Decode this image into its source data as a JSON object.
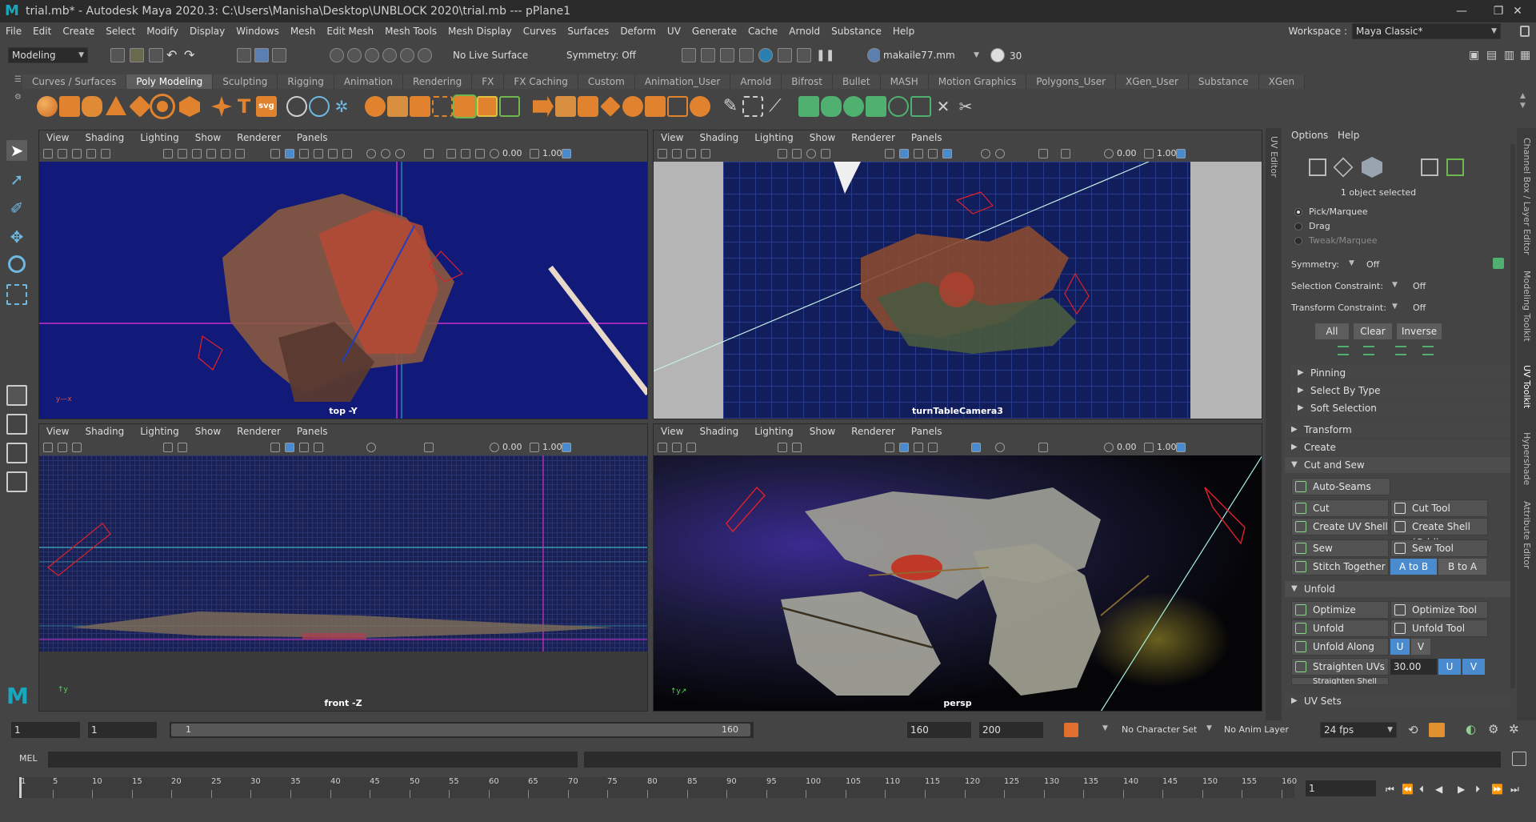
{
  "titlebar": {
    "logo": "M",
    "title": "trial.mb* - Autodesk Maya 2020.3: C:\\Users\\Manisha\\Desktop\\UNBLOCK 2020\\trial.mb  ---  pPlane1",
    "minimize": "—",
    "restore": "❐",
    "close": "✕"
  },
  "menubar": {
    "items": [
      "File",
      "Edit",
      "Create",
      "Select",
      "Modify",
      "Display",
      "Windows",
      "Mesh",
      "Edit Mesh",
      "Mesh Tools",
      "Mesh Display",
      "Curves",
      "Surfaces",
      "Deform",
      "UV",
      "Generate",
      "Cache",
      "Arnold",
      "Substance",
      "Help"
    ],
    "workspace_label": "Workspace :",
    "workspace_value": "Maya Classic*"
  },
  "statusline": {
    "menuset": "Modeling",
    "live_surface": "No Live Surface",
    "symmetry": "Symmetry: Off",
    "user": "makaile77.mm",
    "credits": "30"
  },
  "shelf": {
    "tabs": [
      "Curves / Surfaces",
      "Poly Modeling",
      "Sculpting",
      "Rigging",
      "Animation",
      "Rendering",
      "FX",
      "FX Caching",
      "Custom",
      "Animation_User",
      "Arnold",
      "Bifrost",
      "Bullet",
      "MASH",
      "Motion Graphics",
      "Polygons_User",
      "XGen_User",
      "Substance",
      "XGen"
    ],
    "active_tab": "Poly Modeling",
    "text_icons": [
      "T",
      "svg"
    ]
  },
  "viewports": {
    "menu": [
      "View",
      "Shading",
      "Lighting",
      "Show",
      "Renderer",
      "Panels"
    ],
    "value_a": "0.00",
    "value_b": "1.00",
    "top_label": "top -Y",
    "turntable_label": "turnTableCamera3",
    "front_label": "front -Z",
    "persp_label": "persp"
  },
  "uv_editor_tab": "UV Editor",
  "right_tabs": [
    "Channel Box / Layer Editor",
    "Modeling Toolkit",
    "UV Toolkit",
    "Hypershade",
    "Attribute Editor"
  ],
  "toolkit": {
    "menu": [
      "Options",
      "Help"
    ],
    "selected_info": "1 object selected",
    "modes": [
      "Pick/Marquee",
      "Drag",
      "Tweak/Marquee"
    ],
    "symmetry_label": "Symmetry:",
    "symmetry_value": "Off",
    "sel_constraint_label": "Selection Constraint:",
    "sel_constraint_value": "Off",
    "xform_constraint_label": "Transform Constraint:",
    "xform_constraint_value": "Off",
    "sel_buttons": [
      "All",
      "Clear",
      "Inverse"
    ],
    "sub_sections": [
      "Pinning",
      "Select By Type",
      "Soft Selection"
    ],
    "sections": {
      "transform": "Transform",
      "create": "Create",
      "cut_sew": "Cut and Sew",
      "unfold": "Unfold",
      "uv_sets": "UV Sets"
    },
    "cut_sew": {
      "auto_seams": "Auto-Seams",
      "cut": "Cut",
      "cut_tool": "Cut Tool",
      "create_uv_shell": "Create UV Shell",
      "create_shell_grid": "Create Shell (Grid)",
      "sew": "Sew",
      "sew_tool": "Sew Tool",
      "stitch_together": "Stitch Together",
      "a_to_b": "A to B",
      "b_to_a": "B to A"
    },
    "unfold": {
      "optimize": "Optimize",
      "optimize_tool": "Optimize Tool",
      "unfold": "Unfold",
      "unfold_tool": "Unfold Tool",
      "unfold_along": "Unfold Along",
      "u": "U",
      "v": "V",
      "straighten_uvs": "Straighten UVs",
      "straighten_value": "30.00",
      "straighten_shell": "Straighten Shell"
    }
  },
  "range": {
    "start": "1",
    "start_inner": "1",
    "slider_start": "1",
    "slider_end": "160",
    "end_inner": "160",
    "end": "200",
    "character_set": "No Character Set",
    "anim_layer": "No Anim Layer",
    "fps": "24 fps"
  },
  "cmdline": {
    "label": "MEL"
  },
  "timeline": {
    "ticks": [
      "1",
      "5",
      "10",
      "15",
      "20",
      "25",
      "30",
      "35",
      "40",
      "45",
      "50",
      "55",
      "60",
      "65",
      "70",
      "75",
      "80",
      "85",
      "90",
      "95",
      "100",
      "105",
      "110",
      "115",
      "120",
      "125",
      "130",
      "135",
      "140",
      "145",
      "150",
      "155",
      "160"
    ],
    "current_frame": "1",
    "current_marker": "1"
  },
  "colors": {
    "accent_blue": "#4a8bd0",
    "viewport_blue": "#101a73",
    "grid_blue": "#1a2a6a",
    "camera_red": "#e0202a"
  }
}
